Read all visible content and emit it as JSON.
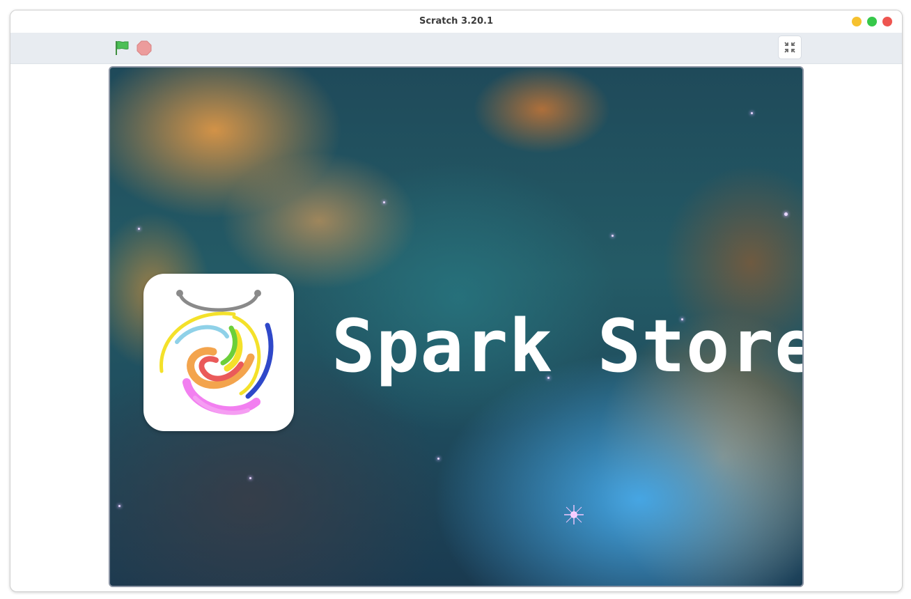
{
  "window": {
    "title": "Scratch 3.20.1"
  },
  "toolbar": {
    "green_flag_icon": "green-flag-icon",
    "stop_icon": "stop-icon",
    "fullscreen_icon": "exit-fullscreen-icon"
  },
  "stage": {
    "backdrop": "nebula-space-backdrop",
    "app_icon": "spark-store-logo",
    "title_text": "Spark Store"
  },
  "colors": {
    "flag_green": "#4cbf56",
    "stop_red": "#ec9c9c",
    "stage_border": "#8a93a3",
    "toolbar_bg": "#e8ecf1"
  }
}
